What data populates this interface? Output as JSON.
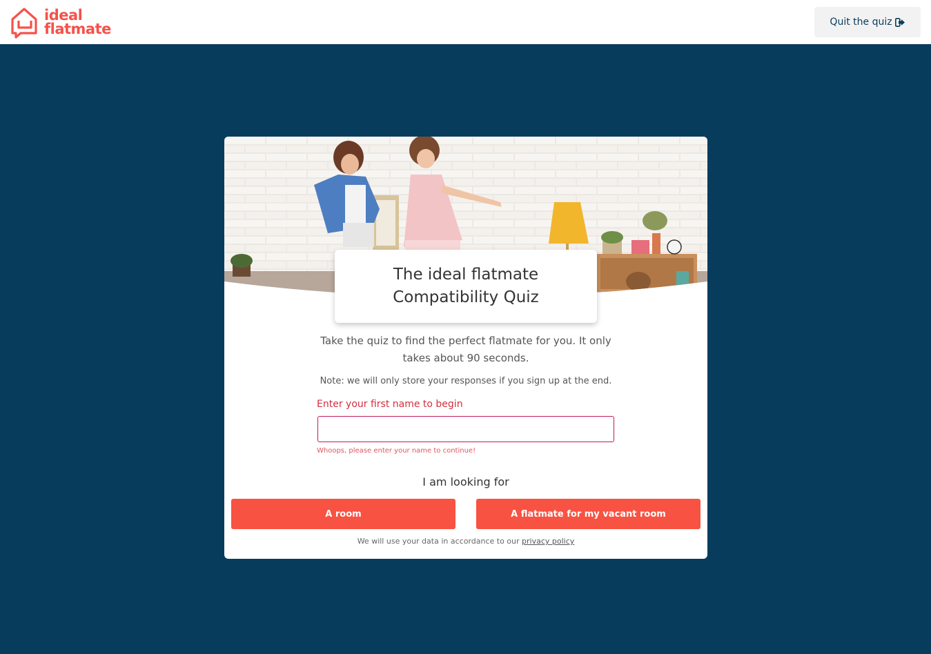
{
  "brand": {
    "logo_line1": "ideal",
    "logo_line2": "flatmate",
    "color": "#f5524a"
  },
  "header": {
    "quit_label": "Quit the quiz",
    "quit_icon": "sign-out-icon"
  },
  "quiz": {
    "title": "The ideal flatmate Compatibility Quiz",
    "intro": "Take the quiz to find the perfect flatmate for you. It only takes about 90 seconds.",
    "note": "Note: we will only store your responses if you sign up at the end.",
    "name_label": "Enter your first name to begin",
    "name_value": "",
    "name_placeholder": "",
    "error_message": "Whoops, please enter your name to continue!",
    "looking_for_label": "I am looking for",
    "options": [
      {
        "label": "A room"
      },
      {
        "label": "A flatmate for my vacant room"
      }
    ],
    "privacy_text": "We will use your data in accordance to our",
    "privacy_link": "privacy policy"
  },
  "colors": {
    "background": "#083c5d",
    "accent": "#f85242",
    "error": "#d42e3d",
    "input_border": "#c2185b"
  }
}
